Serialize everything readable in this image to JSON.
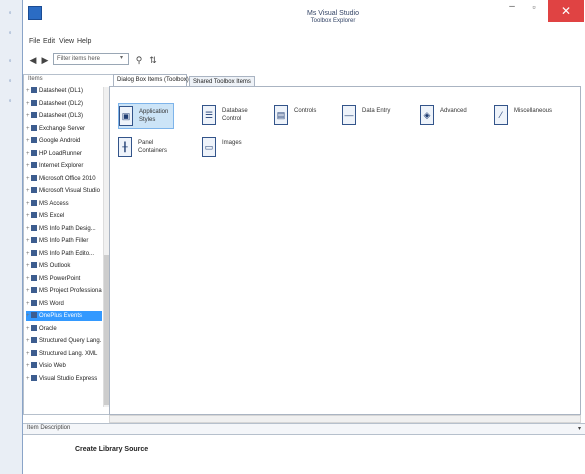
{
  "window": {
    "title": "Ms Visual Studio",
    "subtitle": "Toolbox Explorer",
    "minimize_glyph": "–",
    "maximize_glyph": "▫",
    "close_glyph": "✕"
  },
  "menu": [
    "File",
    "Edit",
    "View",
    "Help"
  ],
  "toolbar": {
    "back_glyph": "◀",
    "forward_glyph": "▶",
    "search_placeholder": "Filter items here",
    "find_glyph": "⚲",
    "sort_glyph": "⇅"
  },
  "tree": {
    "header": "Items",
    "items": [
      "Datasheet (DL1)",
      "Datasheet (DL2)",
      "Datasheet (DL3)",
      "Exchange Server",
      "Google Android",
      "HP LoadRunner",
      "Internet Explorer",
      "Microsoft Office 2010",
      "Microsoft Visual Studio",
      "MS Access",
      "MS Excel",
      "MS Info Path Desig...",
      "MS Info Path Filler",
      "MS Info Path Edito...",
      "MS Outlook",
      "MS PowerPoint",
      "MS Project Professional",
      "MS Word",
      "OnePlus Events",
      "Oracle",
      "Structured Query Lang.",
      "Structured Lang. XML",
      "Visio Web",
      "Visual Studio Express"
    ],
    "selected_index": 18
  },
  "tabs": [
    "Dialog Box Items (Toolbox)",
    "Shared Toolbox Items"
  ],
  "tools": [
    {
      "label": "Application\nStyles",
      "icon": "app-style-icon",
      "glyph": "▣"
    },
    {
      "label": "Database\nControl",
      "icon": "database-icon",
      "glyph": "☰"
    },
    {
      "label": "Controls",
      "icon": "controls-icon",
      "glyph": "▤"
    },
    {
      "label": "Data Entry",
      "icon": "data-entry-icon",
      "glyph": "—"
    },
    {
      "label": "Advanced",
      "icon": "advanced-icon",
      "glyph": "◈"
    },
    {
      "label": "Miscellaneous",
      "icon": "misc-icon",
      "glyph": "⁄"
    },
    {
      "label": "Panel\nContainers",
      "icon": "panel-icon",
      "glyph": "╂"
    },
    {
      "label": "Images",
      "icon": "images-icon",
      "glyph": "▭"
    }
  ],
  "description": {
    "label": "Item Description",
    "text": "Create Library Source"
  }
}
